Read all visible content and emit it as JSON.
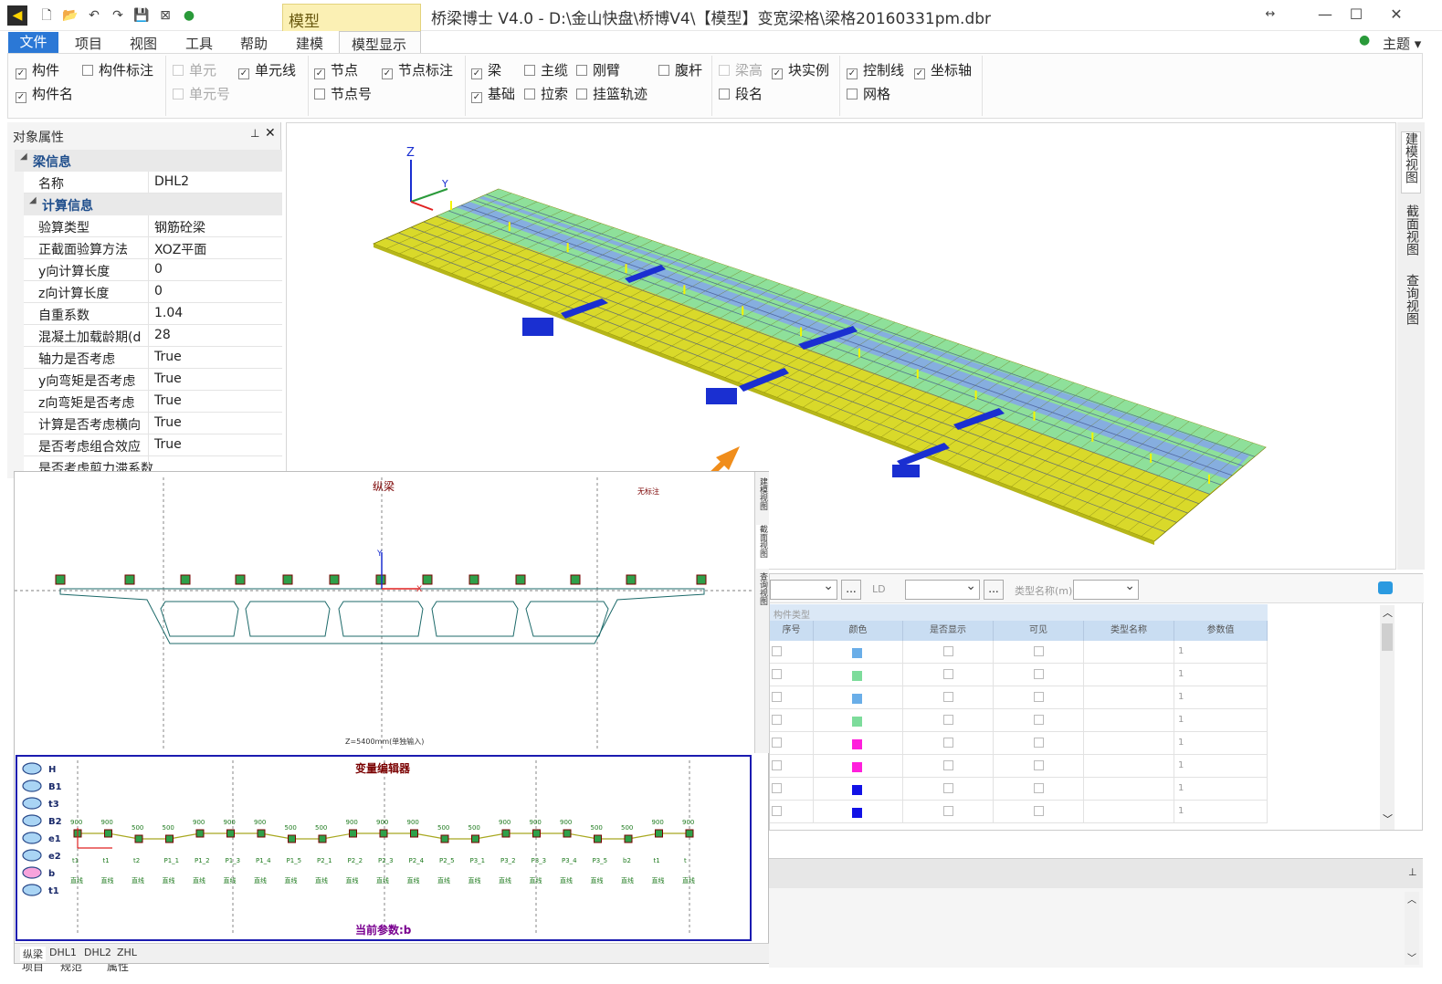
{
  "app": {
    "title": "桥梁博士 V4.0 - D:\\金山快盘\\桥博V4\\【模型】变宽梁格\\梁格20160331pm.dbr",
    "context_tab": "模型",
    "theme_label": "主题"
  },
  "menu": {
    "file": "文件",
    "items": [
      "项目",
      "视图",
      "工具",
      "帮助"
    ],
    "ribbon_tabs": [
      "建模",
      "模型显示"
    ]
  },
  "ribbon": {
    "options": [
      {
        "label": "构件",
        "checked": true,
        "enabled": true
      },
      {
        "label": "构件名",
        "checked": true,
        "enabled": true
      },
      {
        "label": "构件标注",
        "checked": false,
        "enabled": true
      },
      {
        "label": "单元",
        "checked": false,
        "enabled": false
      },
      {
        "label": "单元号",
        "checked": false,
        "enabled": false
      },
      {
        "label": "单元线",
        "checked": true,
        "enabled": true
      },
      {
        "label": "节点",
        "checked": true,
        "enabled": true
      },
      {
        "label": "节点号",
        "checked": false,
        "enabled": true
      },
      {
        "label": "节点标注",
        "checked": true,
        "enabled": true
      },
      {
        "label": "梁",
        "checked": true,
        "enabled": true
      },
      {
        "label": "基础",
        "checked": true,
        "enabled": true
      },
      {
        "label": "主缆",
        "checked": false,
        "enabled": true
      },
      {
        "label": "拉索",
        "checked": false,
        "enabled": true
      },
      {
        "label": "刚臂",
        "checked": false,
        "enabled": true
      },
      {
        "label": "挂篮轨迹",
        "checked": false,
        "enabled": true
      },
      {
        "label": "腹杆",
        "checked": false,
        "enabled": true
      },
      {
        "label": "梁高",
        "checked": false,
        "enabled": false
      },
      {
        "label": "段名",
        "checked": false,
        "enabled": true
      },
      {
        "label": "块实例",
        "checked": true,
        "enabled": true
      },
      {
        "label": "控制线",
        "checked": true,
        "enabled": true
      },
      {
        "label": "网格",
        "checked": false,
        "enabled": true
      },
      {
        "label": "坐标轴",
        "checked": true,
        "enabled": true
      }
    ]
  },
  "properties": {
    "panel_title": "对象属性",
    "category_beam": "梁信息",
    "name_label": "名称",
    "name_value": "DHL2",
    "category_calc": "计算信息",
    "rows": [
      {
        "name": "验算类型",
        "value": "钢筋砼梁"
      },
      {
        "name": "正截面验算方法",
        "value": "XOZ平面"
      },
      {
        "name": "y向计算长度",
        "value": "0"
      },
      {
        "name": "z向计算长度",
        "value": "0"
      },
      {
        "name": "自重系数",
        "value": "1.04"
      },
      {
        "name": "混凝土加载龄期(d",
        "value": "28"
      },
      {
        "name": "轴力是否考虑",
        "value": "True"
      },
      {
        "name": "y向弯矩是否考虑",
        "value": "True"
      },
      {
        "name": "z向弯矩是否考虑",
        "value": "True"
      },
      {
        "name": "计算是否考虑横向",
        "value": "True"
      },
      {
        "name": "是否考虑组合效应",
        "value": "True"
      },
      {
        "name": "是否考虑剪力滞系数",
        "value": ""
      }
    ]
  },
  "view3d": {
    "axis_z": "Z",
    "axis_y": "Y",
    "side_tabs": [
      "建模视图",
      "截面视图",
      "查询视图"
    ]
  },
  "section_view": {
    "title": "纵梁",
    "note": "无标注",
    "footer": "Z=5400mm(单独输入)",
    "axis_y": "Y",
    "axis_x": "X",
    "side_tabs": [
      "建模视图",
      "截面视图",
      "查询视图"
    ]
  },
  "var_editor": {
    "title": "变量编辑器",
    "params": [
      "H",
      "B1",
      "t3",
      "B2",
      "e1",
      "e2",
      "b",
      "t1"
    ],
    "values": [
      "900",
      "900",
      "500",
      "500",
      "900",
      "900",
      "900",
      "500",
      "500",
      "900",
      "900",
      "900",
      "500",
      "500",
      "900",
      "900",
      "900",
      "500",
      "500",
      "900",
      "900"
    ],
    "points": [
      "t1",
      "t1",
      "t2",
      "P1_1",
      "P1_2",
      "P1_3",
      "P1_4",
      "P1_5",
      "P2_1",
      "P2_2",
      "P2_3",
      "P2_4",
      "P2_5",
      "P3_1",
      "P3_2",
      "P3_3",
      "P3_4",
      "P3_5",
      "b2",
      "t1",
      "t"
    ],
    "types": [
      "直线",
      "直线",
      "直线",
      "直线",
      "直线",
      "直线",
      "直线",
      "直线",
      "直线",
      "直线",
      "直线",
      "直线",
      "直线",
      "直线",
      "直线",
      "直线",
      "直线",
      "直线",
      "直线",
      "直线",
      "直线"
    ],
    "current": "当前参数:b"
  },
  "float_tabs": [
    "纵梁",
    "DHL1",
    "DHL2",
    "ZHL"
  ],
  "bottom_tabs": [
    "项目",
    "规范",
    "属性"
  ],
  "grid": {
    "toolbar_labels": [
      "LD",
      "类型名称(m)"
    ],
    "group_label": "构件类型",
    "columns": [
      "序号",
      "颜色",
      "是否显示",
      "可见",
      "类型名称",
      "参数值"
    ],
    "rows": [
      {
        "color": "#6aaee8",
        "value": "1"
      },
      {
        "color": "#7ddc9b",
        "value": "1"
      },
      {
        "color": "#6aaee8",
        "value": "1"
      },
      {
        "color": "#7ddc9b",
        "value": "1"
      },
      {
        "color": "#ff1fdc",
        "value": "1"
      },
      {
        "color": "#ff1fdc",
        "value": "1"
      },
      {
        "color": "#1212e6",
        "value": "1"
      },
      {
        "color": "#1212e6",
        "value": "1"
      }
    ]
  },
  "colors": {
    "deck_yellow": "#d9d92a",
    "deck_green": "#8ee09a",
    "deck_blue": "#86aedf",
    "accent_blue": "#2b78d6",
    "arrow_orange": "#f08d1b"
  }
}
